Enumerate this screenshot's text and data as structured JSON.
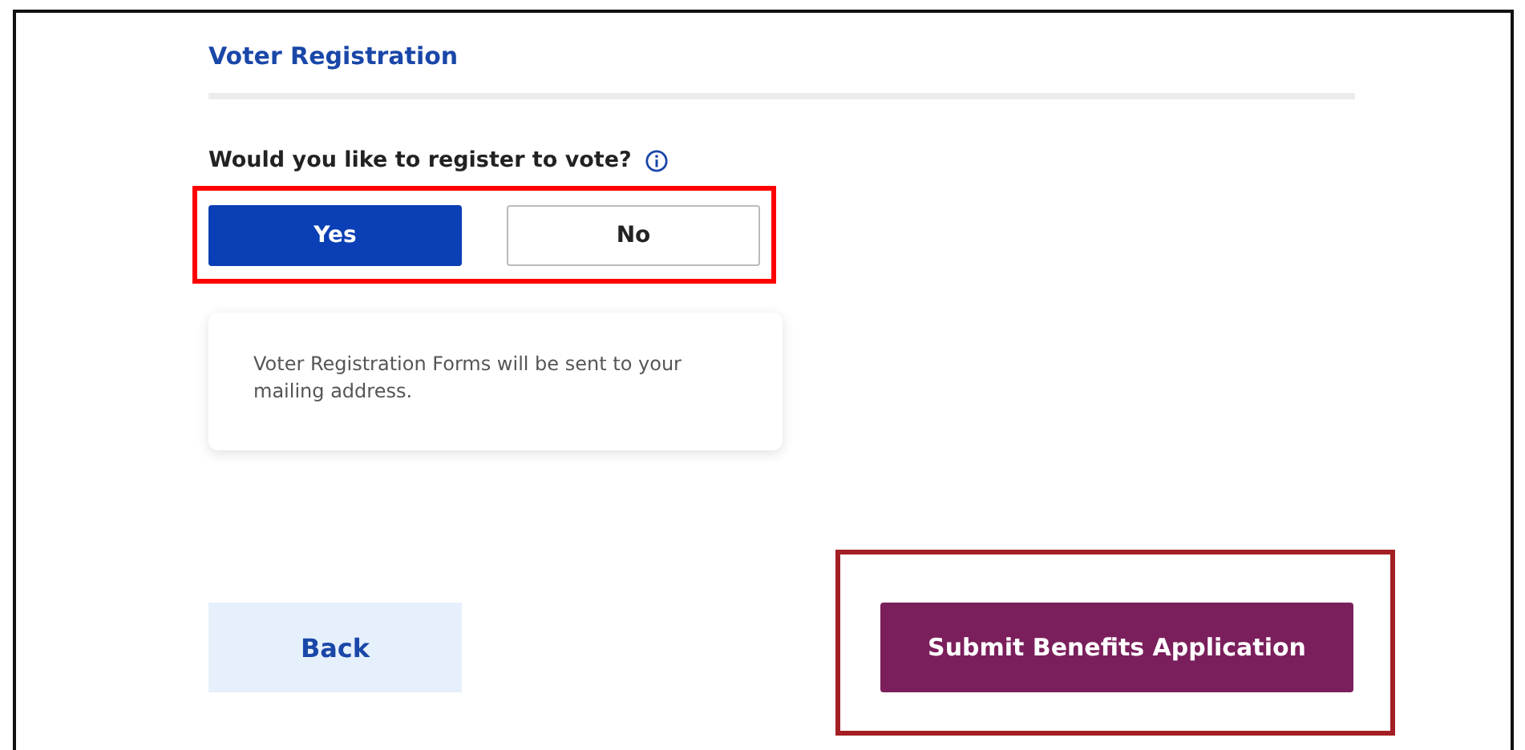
{
  "section": {
    "title": "Voter Registration"
  },
  "question": {
    "text": "Would you like to register to vote?",
    "has_info": true
  },
  "options": [
    {
      "label": "Yes",
      "selected": true
    },
    {
      "label": "No",
      "selected": false
    }
  ],
  "note": "Voter Registration Forms will be sent to your mailing address.",
  "buttons": {
    "back": "Back",
    "submit": "Submit Benefits Application"
  },
  "highlights": {
    "options": {
      "color": "#ff0000"
    },
    "submit": {
      "color": "#a31f24"
    }
  }
}
